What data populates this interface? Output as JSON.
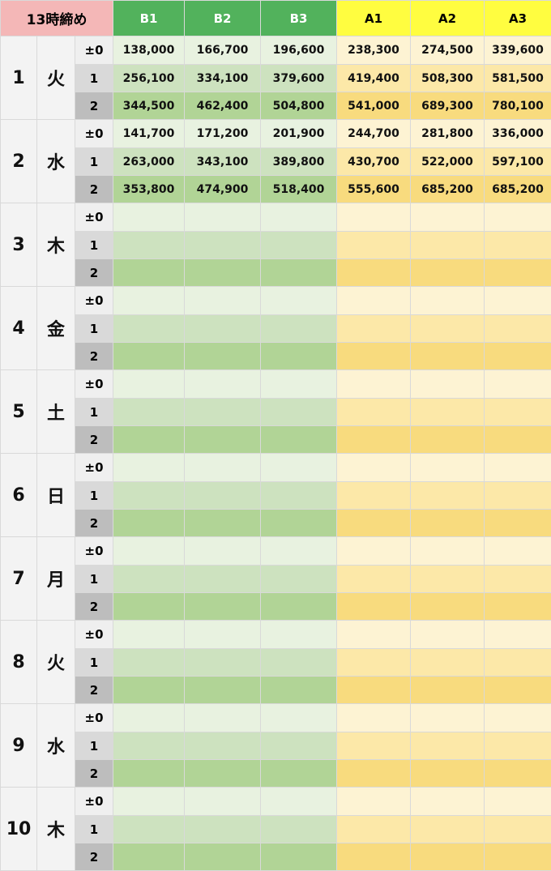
{
  "header": {
    "corner": "13時締め",
    "b_cols": [
      "B1",
      "B2",
      "B3"
    ],
    "a_cols": [
      "A1",
      "A2",
      "A3"
    ]
  },
  "offsets": [
    "±0",
    "1",
    "2"
  ],
  "days": [
    {
      "date": "1",
      "dow": "火",
      "rows": [
        [
          "138,000",
          "166,700",
          "196,600",
          "238,300",
          "274,500",
          "339,600"
        ],
        [
          "256,100",
          "334,100",
          "379,600",
          "419,400",
          "508,300",
          "581,500"
        ],
        [
          "344,500",
          "462,400",
          "504,800",
          "541,000",
          "689,300",
          "780,100"
        ]
      ]
    },
    {
      "date": "2",
      "dow": "水",
      "rows": [
        [
          "141,700",
          "171,200",
          "201,900",
          "244,700",
          "281,800",
          "336,000"
        ],
        [
          "263,000",
          "343,100",
          "389,800",
          "430,700",
          "522,000",
          "597,100"
        ],
        [
          "353,800",
          "474,900",
          "518,400",
          "555,600",
          "685,200",
          "685,200"
        ]
      ]
    },
    {
      "date": "3",
      "dow": "木",
      "rows": [
        [
          "",
          "",
          "",
          "",
          "",
          ""
        ],
        [
          "",
          "",
          "",
          "",
          "",
          ""
        ],
        [
          "",
          "",
          "",
          "",
          "",
          ""
        ]
      ]
    },
    {
      "date": "4",
      "dow": "金",
      "rows": [
        [
          "",
          "",
          "",
          "",
          "",
          ""
        ],
        [
          "",
          "",
          "",
          "",
          "",
          ""
        ],
        [
          "",
          "",
          "",
          "",
          "",
          ""
        ]
      ]
    },
    {
      "date": "5",
      "dow": "土",
      "rows": [
        [
          "",
          "",
          "",
          "",
          "",
          ""
        ],
        [
          "",
          "",
          "",
          "",
          "",
          ""
        ],
        [
          "",
          "",
          "",
          "",
          "",
          ""
        ]
      ]
    },
    {
      "date": "6",
      "dow": "日",
      "rows": [
        [
          "",
          "",
          "",
          "",
          "",
          ""
        ],
        [
          "",
          "",
          "",
          "",
          "",
          ""
        ],
        [
          "",
          "",
          "",
          "",
          "",
          ""
        ]
      ]
    },
    {
      "date": "7",
      "dow": "月",
      "rows": [
        [
          "",
          "",
          "",
          "",
          "",
          ""
        ],
        [
          "",
          "",
          "",
          "",
          "",
          ""
        ],
        [
          "",
          "",
          "",
          "",
          "",
          ""
        ]
      ]
    },
    {
      "date": "8",
      "dow": "火",
      "rows": [
        [
          "",
          "",
          "",
          "",
          "",
          ""
        ],
        [
          "",
          "",
          "",
          "",
          "",
          ""
        ],
        [
          "",
          "",
          "",
          "",
          "",
          ""
        ]
      ]
    },
    {
      "date": "9",
      "dow": "水",
      "rows": [
        [
          "",
          "",
          "",
          "",
          "",
          ""
        ],
        [
          "",
          "",
          "",
          "",
          "",
          ""
        ],
        [
          "",
          "",
          "",
          "",
          "",
          ""
        ]
      ]
    },
    {
      "date": "10",
      "dow": "木",
      "rows": [
        [
          "",
          "",
          "",
          "",
          "",
          ""
        ],
        [
          "",
          "",
          "",
          "",
          "",
          ""
        ],
        [
          "",
          "",
          "",
          "",
          "",
          ""
        ]
      ]
    }
  ]
}
